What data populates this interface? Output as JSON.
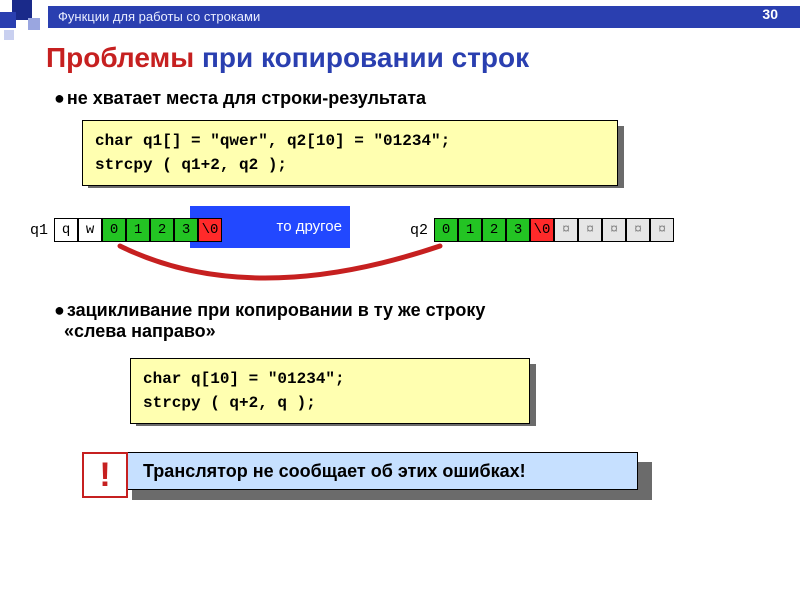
{
  "header": {
    "breadcrumb": "Функции для работы со строками",
    "page": "30"
  },
  "title": {
    "problem": "Проблемы",
    "rest": " при копировании строк"
  },
  "bullets": {
    "b1": "не хватает места для строки-результата",
    "b2a": "зацикливание при копировании в ту же строку",
    "b2b": "«слева направо»"
  },
  "code1": "char q1[] = \"qwer\", q2[10] = \"01234\";\nstrcpy ( q1+2, q2 );",
  "code2": "char q[10] = \"01234\";\nstrcpy ( q+2, q );",
  "mem": {
    "q1_label": "q1",
    "q1_cells": [
      {
        "v": "q",
        "c": ""
      },
      {
        "v": "w",
        "c": ""
      },
      {
        "v": "0",
        "c": "green"
      },
      {
        "v": "1",
        "c": "green"
      },
      {
        "v": "2",
        "c": "green"
      },
      {
        "v": "3",
        "c": "green"
      },
      {
        "v": "\\0",
        "c": "red"
      }
    ],
    "overflow_text": "то другое",
    "q2_label": "q2",
    "q2_cells": [
      {
        "v": "0",
        "c": "green"
      },
      {
        "v": "1",
        "c": "green"
      },
      {
        "v": "2",
        "c": "green"
      },
      {
        "v": "3",
        "c": "green"
      },
      {
        "v": "\\0",
        "c": "red"
      },
      {
        "v": "¤",
        "c": "gray"
      },
      {
        "v": "¤",
        "c": "gray"
      },
      {
        "v": "¤",
        "c": "gray"
      },
      {
        "v": "¤",
        "c": "gray"
      },
      {
        "v": "¤",
        "c": "gray"
      }
    ]
  },
  "warning": {
    "mark": "!",
    "text": "Транслятор не сообщает об этих ошибках!"
  }
}
